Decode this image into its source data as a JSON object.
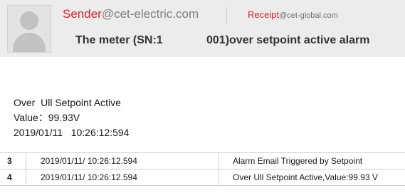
{
  "header": {
    "sender_name": "Sender",
    "sender_domain": "@cet-electric.com",
    "receipt_name": "Receipt",
    "receipt_domain": "@cet-global.com",
    "subject_left": "The meter (SN:1",
    "subject_right": "001)over setpoint active alarm"
  },
  "body": {
    "line1": "Over  Ull Setpoint Active",
    "line2": "Value：99.93V",
    "line3": "2019/01/11   10:26:12:594"
  },
  "events": [
    {
      "num": "3",
      "time": "2019/01/11/ 10:26:12.594",
      "message": "Alarm Email Triggered by Setpoint"
    },
    {
      "num": "4",
      "time": "2019/01/11/ 10:26:12.594",
      "message": "Over Ull Setpoint Active,Value:99.93 V"
    }
  ]
}
